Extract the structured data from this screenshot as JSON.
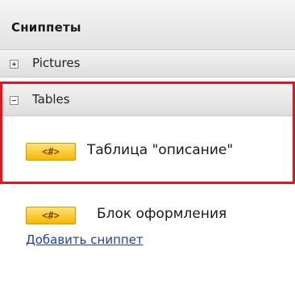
{
  "panel": {
    "title": "Сниппеты"
  },
  "groups": [
    {
      "label": "Pictures",
      "state": "collapsed",
      "toggle_icon": "plus-icon"
    },
    {
      "label": "Tables",
      "state": "expanded",
      "toggle_icon": "minus-icon"
    }
  ],
  "snippets": [
    {
      "badge": "<#>",
      "label": "Таблица \"описание\""
    },
    {
      "badge": "<#>",
      "label": "Блок оформления"
    }
  ],
  "actions": {
    "add_snippet": "Добавить сниппет"
  },
  "colors": {
    "highlight_border": "#e8141b",
    "badge_fill": "#f5b800",
    "link": "#1c3fb0"
  }
}
